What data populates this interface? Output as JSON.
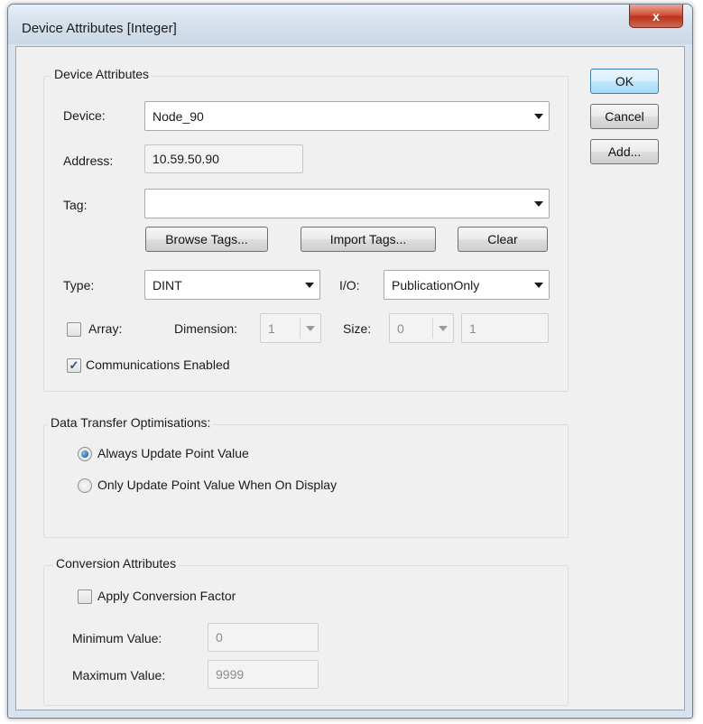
{
  "window": {
    "title": "Device Attributes  [Integer]",
    "close_glyph": "x"
  },
  "actions": {
    "ok": "OK",
    "cancel": "Cancel",
    "add": "Add..."
  },
  "device_group": {
    "title": "Device Attributes",
    "device_label": "Device:",
    "device_value": "Node_90",
    "address_label": "Address:",
    "address_value": "10.59.50.90",
    "tag_label": "Tag:",
    "tag_value": "",
    "browse_tags": "Browse Tags...",
    "import_tags": "Import Tags...",
    "clear": "Clear",
    "type_label": "Type:",
    "type_value": "DINT",
    "io_label": "I/O:",
    "io_value": "PublicationOnly",
    "array_label": "Array:",
    "array_checked": false,
    "dimension_label": "Dimension:",
    "dimension_value": "1",
    "size_label": "Size:",
    "size_value": "0",
    "size_count_value": "1",
    "comms_label": "Communications Enabled",
    "comms_checked": true
  },
  "data_transfer_group": {
    "title": "Data Transfer Optimisations:",
    "options": [
      {
        "label": "Always Update Point Value",
        "selected": true
      },
      {
        "label": "Only Update Point Value When On Display",
        "selected": false
      }
    ]
  },
  "conversion_group": {
    "title": "Conversion Attributes",
    "apply_label": "Apply Conversion Factor",
    "apply_checked": false,
    "min_label": "Minimum Value:",
    "min_value": "0",
    "max_label": "Maximum Value:",
    "max_value": "9999"
  },
  "colors": {
    "accent": "#3c7fb1",
    "close_button": "#c94a32",
    "dialog_background": "#f0f0f0"
  },
  "icons": {
    "dropdown": "chevron-down-icon",
    "close": "close-icon",
    "check": "checkmark-icon"
  }
}
